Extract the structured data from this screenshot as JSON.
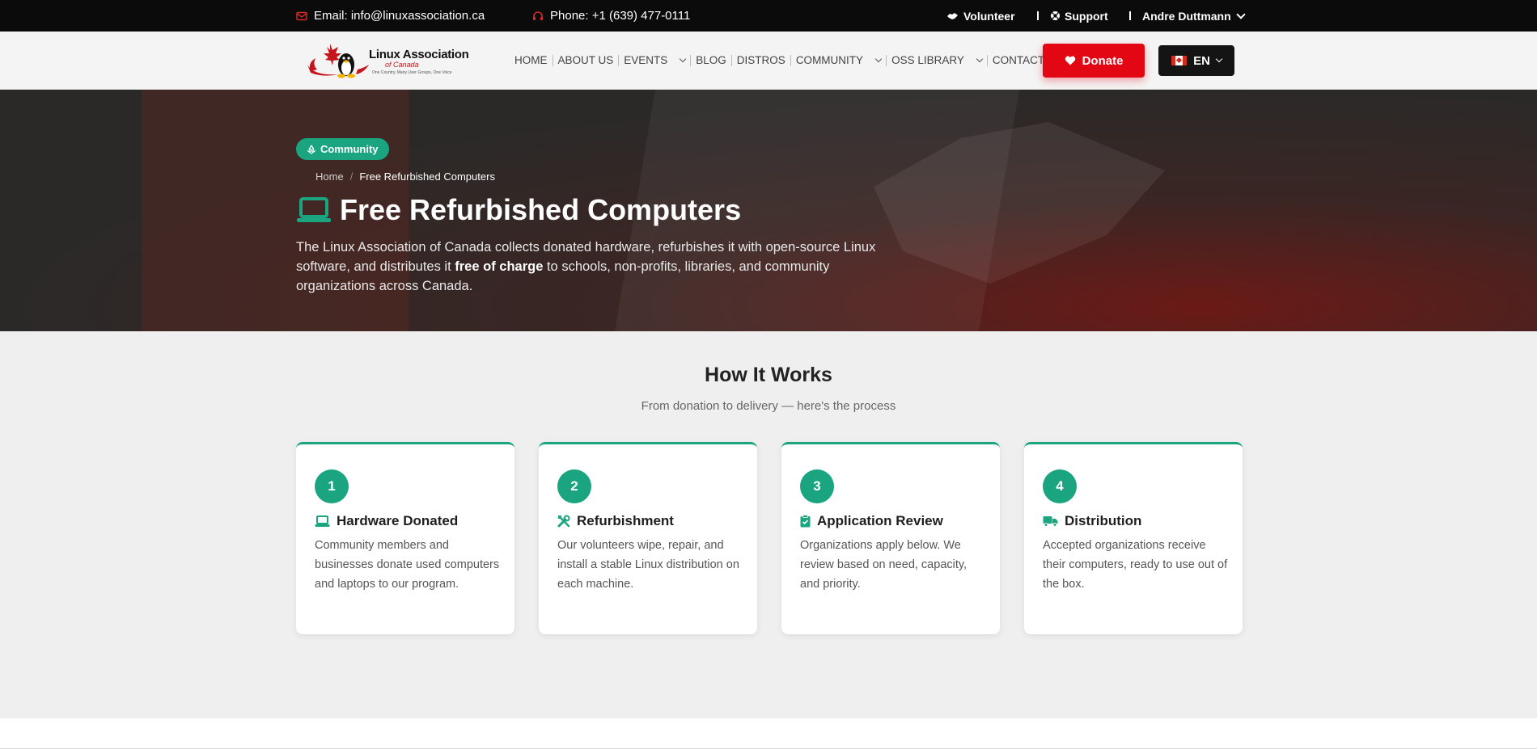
{
  "topbar": {
    "email": "Email: info@linuxassociation.ca",
    "phone": "Phone: +1 (639) 477-0111",
    "volunteer": "Volunteer",
    "support": "Support",
    "user": "Andre Duttmann"
  },
  "logo": {
    "line1": "Linux Association",
    "line2": "of Canada",
    "line3": "One Country, Many User Groups, One Voice"
  },
  "nav": {
    "items": [
      "HOME",
      "ABOUT US",
      "EVENTS",
      "BLOG",
      "DISTROS",
      "COMMUNITY",
      "OSS LIBRARY",
      "CONTACT US"
    ]
  },
  "donate": {
    "label": "Donate"
  },
  "lang": {
    "label": "EN"
  },
  "hero": {
    "badge": "Community",
    "crumb_home": "Home",
    "crumb_sep": "/",
    "crumb_current": "Free Refurbished Computers",
    "title": "Free Refurbished Computers",
    "desc_before": "The Linux Association of Canada collects donated hardware, refurbishes it with open-source Linux software, and distributes it ",
    "desc_bold": "free of charge",
    "desc_after": " to schools, non-profits, libraries, and community organizations across Canada."
  },
  "how": {
    "title": "How It Works",
    "subtitle": "From donation to delivery — here's the process",
    "steps": [
      {
        "num": "1",
        "title": "Hardware Donated",
        "icon": "laptop-icon",
        "desc": "Community members and businesses donate used computers and laptops to our program."
      },
      {
        "num": "2",
        "title": "Refurbishment",
        "icon": "tools-icon",
        "desc": "Our volunteers wipe, repair, and install a stable Linux distribution on each machine."
      },
      {
        "num": "3",
        "title": "Application Review",
        "icon": "clipboard-check-icon",
        "desc": "Organizations apply below. We review based on need, capacity, and priority."
      },
      {
        "num": "4",
        "title": "Distribution",
        "icon": "truck-icon",
        "desc": "Accepted organizations receive their computers, ready to use out of the box."
      }
    ]
  },
  "colors": {
    "accent": "#1aa580",
    "brand_red": "#e30613",
    "topbar": "#0b0b0b"
  }
}
